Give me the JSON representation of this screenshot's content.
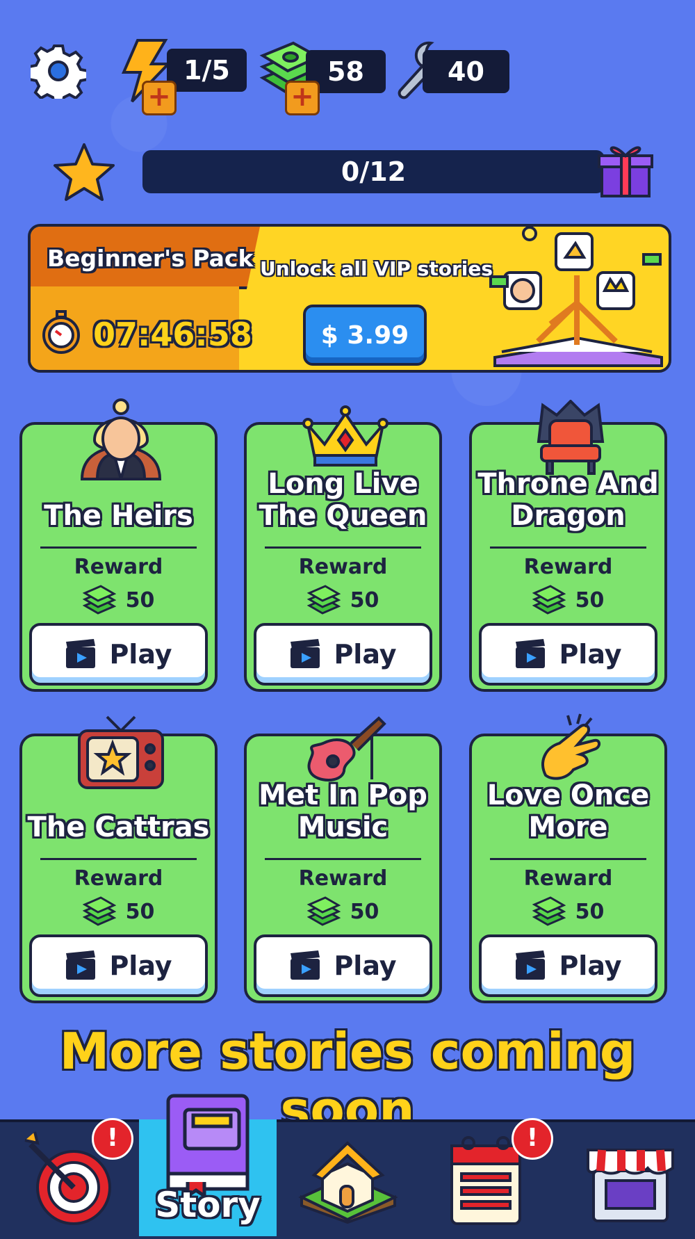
{
  "topbar": {
    "energy": "1/5",
    "cash": "58",
    "tools": "40"
  },
  "progress": {
    "text": "0/12",
    "fraction": 0.0
  },
  "banner": {
    "title": "Beginner's Pack",
    "timer": "07:46:58",
    "subtitle": "Unlock all VIP stories",
    "price": "$ 3.99"
  },
  "stories": [
    {
      "title": "The Heirs",
      "reward_label": "Reward",
      "reward": "50",
      "play": "Play"
    },
    {
      "title": "Long Live The Queen",
      "reward_label": "Reward",
      "reward": "50",
      "play": "Play"
    },
    {
      "title": "Throne And Dragon",
      "reward_label": "Reward",
      "reward": "50",
      "play": "Play"
    },
    {
      "title": "The Cattras",
      "reward_label": "Reward",
      "reward": "50",
      "play": "Play"
    },
    {
      "title": "Met In Pop Music",
      "reward_label": "Reward",
      "reward": "50",
      "play": "Play"
    },
    {
      "title": "Love Once More",
      "reward_label": "Reward",
      "reward": "50",
      "play": "Play"
    }
  ],
  "coming_soon": "More stories coming soon",
  "nav": {
    "active_label": "Story",
    "badge": "!"
  },
  "colors": {
    "accent": "#ffd21a",
    "card": "#7ee36e",
    "background": "#5a7af0"
  }
}
